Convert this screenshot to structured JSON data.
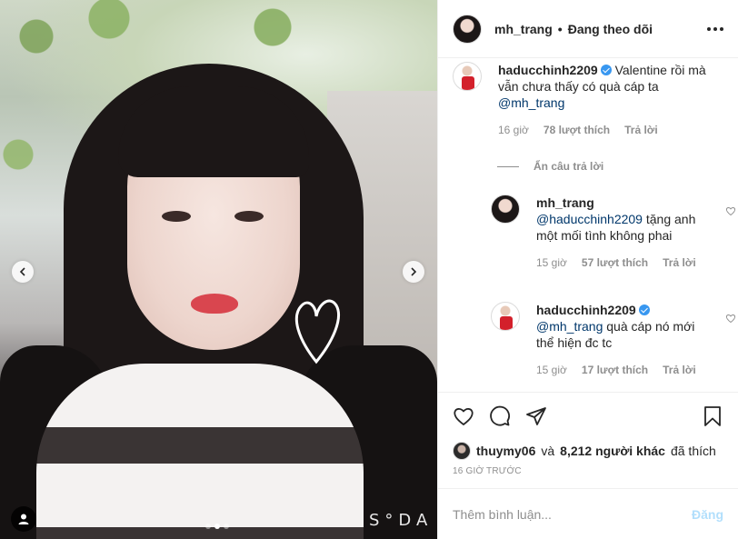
{
  "photo": {
    "watermark": "S°DA",
    "carousel_count": 3,
    "carousel_active_index": 1
  },
  "header": {
    "username": "mh_trang",
    "separator": "•",
    "follow_status": "Đang theo dõi"
  },
  "comments": [
    {
      "username": "haducchinh2209",
      "verified": true,
      "text": "Valentine rồi mà vẫn chưa thấy có quà cáp ta",
      "mention": "@mh_trang",
      "time": "16 giờ",
      "likes": "78 lượt thích",
      "reply": "Trả lời"
    }
  ],
  "hide_replies_label": "Ẩn câu trả lời",
  "replies": [
    {
      "username": "mh_trang",
      "verified": false,
      "mention": "@haducchinh2209",
      "text": "tặng anh một mối tình không phai",
      "time": "15 giờ",
      "likes": "57 lượt thích",
      "reply": "Trả lời"
    },
    {
      "username": "haducchinh2209",
      "verified": true,
      "mention": "@mh_trang",
      "text": "quà cáp nó mới thể hiện đc tc",
      "time": "15 giờ",
      "likes": "17 lượt thích",
      "reply": "Trả lời"
    }
  ],
  "actions": {
    "icons": [
      "heart-icon",
      "comment-icon",
      "share-icon",
      "bookmark-icon"
    ]
  },
  "likes_summary": {
    "user": "thuymy06",
    "conj": "và",
    "others": "8,212 người khác",
    "suffix": "đã thích"
  },
  "time_ago": "16 GIỜ TRƯỚC",
  "add_comment": {
    "placeholder": "Thêm bình luận...",
    "post_label": "Đăng"
  },
  "colors": {
    "mention": "#00376b",
    "meta": "#8e8e8e",
    "verified": "#3897f0",
    "post_disabled": "#b2dffc"
  }
}
